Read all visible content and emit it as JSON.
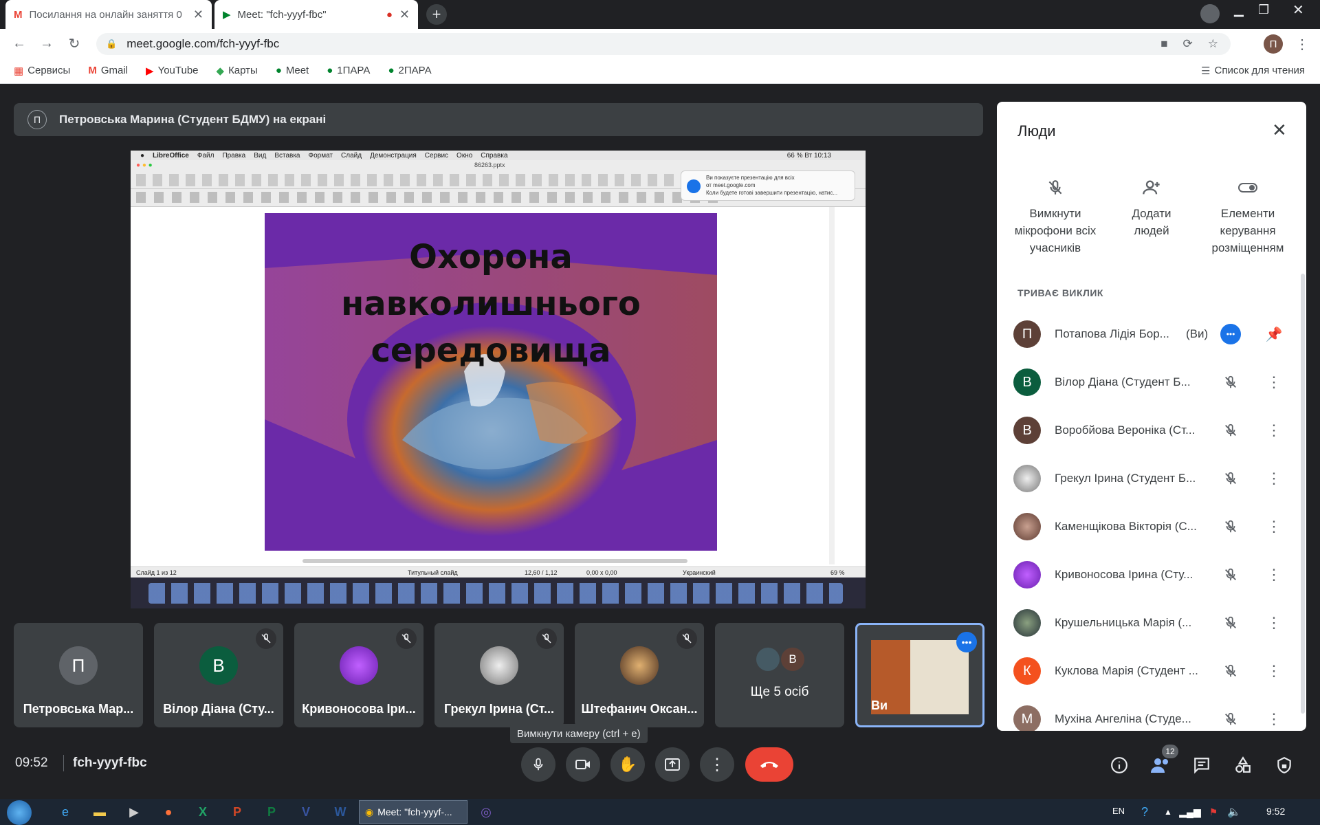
{
  "browser": {
    "tabs": [
      {
        "title": "Посилання на онлайн заняття 0"
      },
      {
        "title": "Meet: \"fch-yyyf-fbc\""
      }
    ],
    "url": "meet.google.com/fch-yyyf-fbc",
    "profile_initial": "П",
    "bookmarks": [
      "Сервисы",
      "Gmail",
      "YouTube",
      "Карты",
      "Meet",
      "1ПАРА",
      "2ПАРА"
    ],
    "reading_list": "Список для чтения"
  },
  "meet": {
    "presenter_banner": "Петровська Марина (Студент БДМУ) на екрані",
    "presenter_initial": "П",
    "shared_screen": {
      "menu": [
        "LibreOffice",
        "Файл",
        "Правка",
        "Вид",
        "Вставка",
        "Формат",
        "Слайд",
        "Демонстрация",
        "Сервис",
        "Окно",
        "Справка"
      ],
      "status_right": "66 %  Вт 10:13",
      "filename": "86263.pptx",
      "notification_line1": "Ви показуєте презентацію для всіх",
      "notification_line2": "от meet.google.com",
      "notification_line3": "Коли будете готові завершити презентацію, натис...",
      "slide_title": "Охорона навколишнього середовища",
      "status_slide": "Слайд 1 из 12",
      "status_layout": "Титульный слайд",
      "status_pos": "12,60 / 1,12",
      "status_size": "0,00 x 0,00",
      "status_lang": "Украинский",
      "status_zoom": "69 %"
    },
    "tiles": [
      {
        "name": "Петровська Мар...",
        "initial": "П",
        "color": "#5f6368"
      },
      {
        "name": "Вілор Діана (Сту...",
        "initial": "В",
        "color": "#0b5d3e"
      },
      {
        "name": "Кривоносова Іри...",
        "initial": "",
        "color": "#7b2fbf"
      },
      {
        "name": "Грекул Ірина (Ст...",
        "initial": "",
        "color": "#9e9e9e"
      },
      {
        "name": "Штефанич Оксан...",
        "initial": "",
        "color": "#6d4c41"
      },
      {
        "name": "Ще 5 осіб",
        "initial": "В",
        "color": "#5d4037"
      },
      {
        "name": "Ви",
        "initial": "",
        "color": "#b65a2a"
      }
    ],
    "tooltip": "Вимкнути камеру (ctrl + e)",
    "clock": "09:52",
    "meeting_code": "fch-yyyf-fbc",
    "people_count": "12"
  },
  "people_panel": {
    "title": "Люди",
    "actions": [
      "Вимкнути мікрофони всіх учасників",
      "Додати людей",
      "Елементи керування розміщенням"
    ],
    "section_label": "ТРИВАЄ ВИКЛИК",
    "participants": [
      {
        "name": "Потапова Лідія Бор...",
        "suffix": "(Ви)",
        "initial": "П",
        "color": "#5d4037"
      },
      {
        "name": "Вілор Діана (Студент Б...",
        "initial": "В",
        "color": "#0b5d3e"
      },
      {
        "name": "Воробйова Вероніка (Ст...",
        "initial": "В",
        "color": "#5d4037"
      },
      {
        "name": "Грекул Ірина (Студент Б...",
        "initial": "",
        "color": "#9e9e9e"
      },
      {
        "name": "Каменщікова Вікторія (С...",
        "initial": "",
        "color": "#8d6e63"
      },
      {
        "name": "Кривоносова Ірина (Сту...",
        "initial": "",
        "color": "#7b2fbf"
      },
      {
        "name": "Крушельницька Марія (...",
        "initial": "",
        "color": "#455a64"
      },
      {
        "name": "Куклова Марія (Студент ...",
        "initial": "К",
        "color": "#f4511e"
      },
      {
        "name": "Мухіна Ангеліна (Студе...",
        "initial": "М",
        "color": "#8d6e63"
      }
    ]
  },
  "taskbar": {
    "active_window": "Meet: \"fch-yyyf-...",
    "lang": "EN",
    "time": "9:52"
  }
}
